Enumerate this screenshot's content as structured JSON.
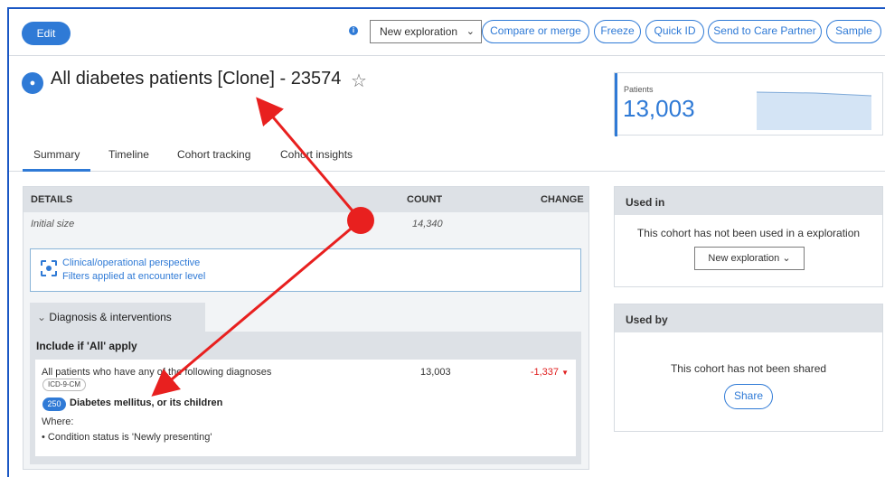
{
  "toolbar": {
    "edit_label": "Edit",
    "info_icon": "info-icon",
    "exploration_select": "New exploration",
    "buttons": [
      "Compare or merge",
      "Freeze",
      "Quick ID",
      "Send to Care Partner",
      "Sample"
    ]
  },
  "header": {
    "title": "All diabetes patients [Clone] - 23574",
    "icon": "cohort-icon",
    "star_icon": "star-outline-icon"
  },
  "patients": {
    "label": "Patients",
    "value": "13,003",
    "sparkline": [
      14340,
      14100,
      13003
    ]
  },
  "tabs": [
    "Summary",
    "Timeline",
    "Cohort tracking",
    "Cohort insights"
  ],
  "active_tab": "Summary",
  "details": {
    "headers": {
      "details": "DETAILS",
      "count": "COUNT",
      "change": "CHANGE"
    },
    "initial_size_label": "Initial size",
    "initial_size_count": "14,340",
    "perspective_line1": "Clinical/operational perspective",
    "perspective_line2": "Filters applied at encounter level",
    "section_label": "Diagnosis & interventions",
    "include_label": "Include if 'All' apply",
    "criterion": {
      "text": "All patients who have any of the following diagnoses",
      "code_system": "ICD-9-CM",
      "count": "13,003",
      "change": "-1,337",
      "code_badge": "250",
      "diagnosis": "Diabetes mellitus, or its children",
      "where_label": "Where:",
      "condition": "Condition status is 'Newly presenting'"
    }
  },
  "used_in": {
    "header": "Used in",
    "message": "This cohort has not been used in a exploration",
    "button": "New exploration"
  },
  "used_by": {
    "header": "Used by",
    "message": "This cohort has not been shared",
    "button": "Share"
  },
  "colors": {
    "accent": "#2f7ad6",
    "negative": "#e02020",
    "annotation": "#e8201f"
  }
}
